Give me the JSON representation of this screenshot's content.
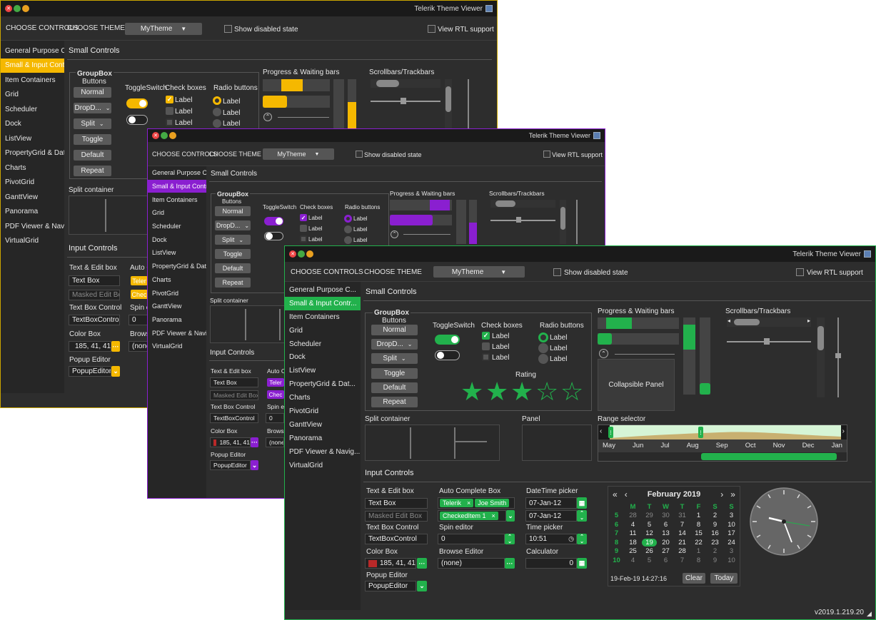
{
  "windows": [
    {
      "title": "Telerik Theme Viewer",
      "accent": "#f5b800",
      "choose_controls": "CHOOSE CONTROLS",
      "choose_theme": "CHOOSE THEME",
      "theme": "MyTheme",
      "show_disabled": "Show disabled state",
      "view_rtl": "View RTL support"
    },
    {
      "title": "Telerik Theme Viewer",
      "accent": "#8a1fd0",
      "choose_controls": "CHOOSE CONTROLS",
      "choose_theme": "CHOOSE THEME",
      "theme": "MyTheme",
      "show_disabled": "Show disabled state",
      "view_rtl": "View RTL support"
    },
    {
      "title": "Telerik Theme Viewer",
      "accent": "#22b14c",
      "choose_controls": "CHOOSE CONTROLS",
      "choose_theme": "CHOOSE THEME",
      "theme": "MyTheme",
      "show_disabled": "Show disabled state",
      "view_rtl": "View RTL support"
    }
  ],
  "nav": [
    "General Purpose C...",
    "Small & Input Contr...",
    "Item Containers",
    "Grid",
    "Scheduler",
    "Dock",
    "ListView",
    "PropertyGrid & Dat...",
    "Charts",
    "PivotGrid",
    "GanttView",
    "Panorama",
    "PDF Viewer & Navig...",
    "VirtualGrid"
  ],
  "nav_selected": 1,
  "small_controls": "Small Controls",
  "input_controls": "Input Controls",
  "groupbox": {
    "title": "GroupBox",
    "sub": "Buttons",
    "buttons": [
      "Normal",
      "DropD...",
      "Split",
      "Toggle",
      "Default",
      "Repeat"
    ]
  },
  "toggle_switch": "ToggleSwitch",
  "check_boxes": "Check boxes",
  "radio_buttons": "Radio buttons",
  "label": "Label",
  "rating": {
    "title": "Rating",
    "value": 3,
    "max": 5
  },
  "progress_title": "Progress & Waiting bars",
  "scroll_title": "Scrollbars/Trackbars",
  "collapsible_panel": "Collapsible Panel",
  "split_container": "Split container",
  "panel": "Panel",
  "range_selector": {
    "title": "Range selector",
    "months": [
      "May",
      "Jun",
      "Jul",
      "Aug",
      "Sep",
      "Oct",
      "Nov",
      "Dec",
      "Jan"
    ]
  },
  "inputs": {
    "text_edit_box": "Text & Edit box",
    "text_box": "Text Box",
    "masked": "Masked Edit Box",
    "text_box_control": "Text Box Control",
    "text_box_control_value": "TextBoxControl",
    "color_box": "Color Box",
    "color_value": "185, 41, 41",
    "color_swatch": "#b92929",
    "popup_editor": "Popup Editor",
    "popup_value": "PopupEditor",
    "auto_complete": "Auto Complete Box",
    "auto_short": "Auto Co",
    "tokens": [
      "Telerik",
      "Joe Smith"
    ],
    "checked_item": "CheckedItem 1",
    "checked_short": "Chec",
    "telerik_short": "Teler",
    "spin_editor": "Spin editor",
    "spin_short": "Spin ed",
    "spin_value": "0",
    "browse_editor": "Browse Editor",
    "browse_short": "Browse",
    "browse_value": "(none)",
    "datetime_picker": "DateTime picker",
    "date1": "07-Jan-12",
    "date2": "07-Jan-12",
    "time_picker": "Time picker",
    "time_value": "10:51",
    "calculator": "Calculator",
    "calc_value": "0"
  },
  "calendar": {
    "month": "February 2019",
    "days": [
      "M",
      "T",
      "W",
      "T",
      "F",
      "S",
      "S"
    ],
    "weeks": [
      "5",
      "6",
      "7",
      "8",
      "9",
      "10"
    ],
    "rows": [
      [
        "28",
        "29",
        "30",
        "31",
        "1",
        "2",
        "3"
      ],
      [
        "4",
        "5",
        "6",
        "7",
        "8",
        "9",
        "10"
      ],
      [
        "11",
        "12",
        "13",
        "14",
        "15",
        "16",
        "17"
      ],
      [
        "18",
        "19",
        "20",
        "21",
        "22",
        "23",
        "24"
      ],
      [
        "25",
        "26",
        "27",
        "28",
        "1",
        "2",
        "3"
      ],
      [
        "4",
        "5",
        "6",
        "7",
        "8",
        "9",
        "10"
      ]
    ],
    "selected": "19",
    "footer_date": "19-Feb-19 14:27:16",
    "clear": "Clear",
    "today": "Today"
  },
  "version": "v2019.1.219.20"
}
